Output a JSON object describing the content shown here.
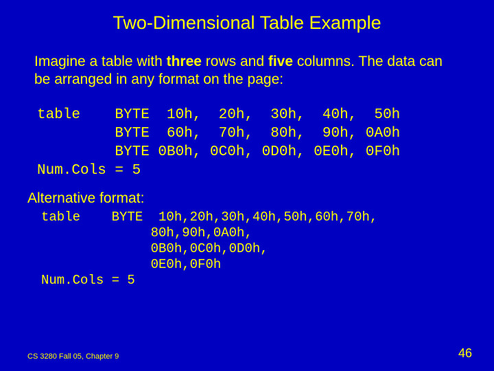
{
  "title": "Two-Dimensional Table Example",
  "intro": {
    "p1a": "Imagine a table with ",
    "p1b": "three",
    "p1c": " rows and ",
    "p1d": "five",
    "p1e": " columns. The data can be arranged in any format on the page:"
  },
  "code1": {
    "l1": "table    BYTE  10h,  20h,  30h,  40h,  50h",
    "l2": "         BYTE  60h,  70h,  80h,  90h, 0A0h",
    "l3": "         BYTE 0B0h, 0C0h, 0D0h, 0E0h, 0F0h",
    "l4": "Num.Cols = 5"
  },
  "alt": "Alternative format:",
  "code2": {
    "l1": "table    BYTE  10h,20h,30h,40h,50h,60h,70h,",
    "l2": "              80h,90h,0A0h,",
    "l3": "              0B0h,0C0h,0D0h,",
    "l4": "              0E0h,0F0h",
    "l5": "Num.Cols = 5"
  },
  "footer": {
    "left": "CS 3280 Fall 05, Chapter 9",
    "right": "46"
  }
}
